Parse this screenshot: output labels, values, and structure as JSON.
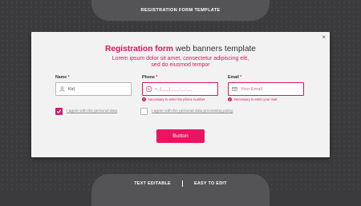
{
  "header_tab": "REGISTRATION FORM TEMPLATE",
  "footer_tabs": [
    "TEXT EDITABLE",
    "EASY TO EDIT"
  ],
  "modal": {
    "title_accent": "Registration form",
    "title_rest": " web banners template",
    "subtitle_line1": "Lorem ipsum dolor sit amet, consectetur adipiscing elit,",
    "subtitle_line2": "sed do eiusmod tempor",
    "close_glyph": "×"
  },
  "fields": {
    "name": {
      "label": "Name",
      "required_mark": "*",
      "value": "Kir|"
    },
    "phone": {
      "label": "Phone",
      "required_mark": "*",
      "placeholder": "+_(___) ___-__-__",
      "error": "Necessary to enter the phone number"
    },
    "email": {
      "label": "Email",
      "required_mark": "*",
      "placeholder": "Your Email",
      "error": "Necessary to enter your mail"
    }
  },
  "error_icon_glyph": "!",
  "checkboxes": [
    {
      "label": "I agree with the personal data",
      "checked": true
    },
    {
      "label": "I agree with the personal data processing policy",
      "checked": false
    }
  ],
  "button_label": "Button",
  "colors": {
    "accent": "#e2135c",
    "background": "#3b3b3d",
    "panel": "#f2f2f3",
    "tab": "#545456"
  },
  "icons": [
    "user-icon",
    "phone-icon",
    "mail-icon",
    "close-icon",
    "error-icon",
    "check-icon"
  ]
}
